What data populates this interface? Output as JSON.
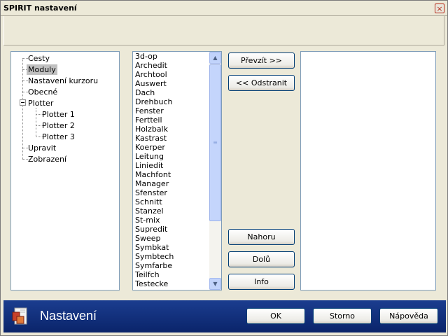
{
  "window": {
    "title": "SPIRIT nastavení",
    "close_glyph": "×"
  },
  "tree": {
    "items": [
      {
        "label": "Cesty",
        "selected": false
      },
      {
        "label": "Moduly",
        "selected": true
      },
      {
        "label": "Nastavení kurzoru",
        "selected": false
      },
      {
        "label": "Obecné",
        "selected": false
      },
      {
        "label": "Plotter",
        "selected": false
      },
      {
        "label": "Plotter 1",
        "selected": false
      },
      {
        "label": "Plotter 2",
        "selected": false
      },
      {
        "label": "Plotter 3",
        "selected": false
      },
      {
        "label": "Upravit",
        "selected": false
      },
      {
        "label": "Zobrazení",
        "selected": false
      }
    ]
  },
  "modules": {
    "items": [
      "3d-op",
      "Archedit",
      "Archtool",
      "Auswert",
      "Dach",
      "Drehbuch",
      "Fenster",
      "Fertteil",
      "Holzbalk",
      "Kastrast",
      "Koerper",
      "Leitung",
      "Liniedit",
      "Machfont",
      "Manager",
      "Sfenster",
      "Schnitt",
      "Stanzel",
      "St-mix",
      "Supredit",
      "Sweep",
      "Symbkat",
      "Symbtech",
      "Symfarbe",
      "Teilfch",
      "Testecke"
    ]
  },
  "buttons": {
    "take": "Převzít >>",
    "remove": "<< Odstranit",
    "up": "Nahoru",
    "down": "Dolů",
    "info": "Info",
    "ok": "OK",
    "cancel": "Storno",
    "help": "Nápověda"
  },
  "footer": {
    "title": "Nastavení"
  },
  "icons": {
    "scroll_up": "▲",
    "scroll_down": "▼",
    "thumb_grip": "≡"
  },
  "colors": {
    "footer_bg": "#0a246a",
    "selected_item_bg": "#c0c0c0",
    "panel_border": "#7f9db9"
  }
}
